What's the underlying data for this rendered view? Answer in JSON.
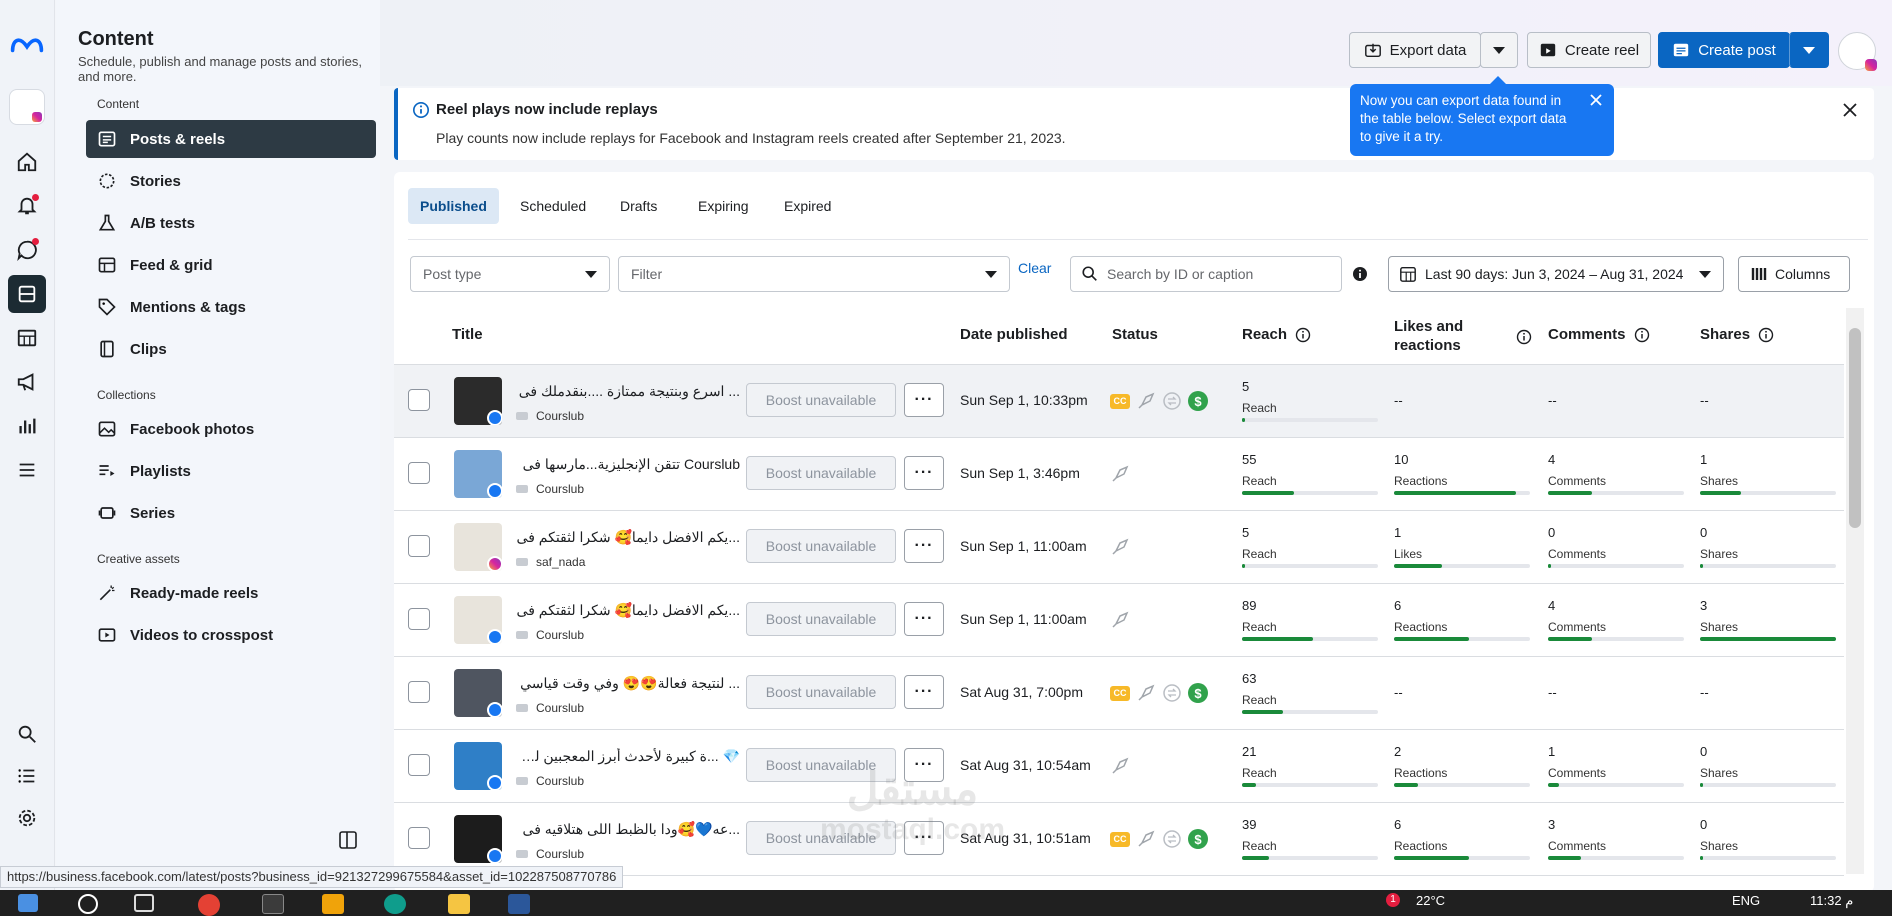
{
  "header": {
    "title": "Content",
    "subtitle": "Schedule, publish and manage posts and stories, and more."
  },
  "sidebar": {
    "sections": [
      {
        "label": "Content",
        "items": [
          {
            "label": "Posts & reels",
            "icon": "posts-icon",
            "active": true
          },
          {
            "label": "Stories",
            "icon": "stories-icon"
          },
          {
            "label": "A/B tests",
            "icon": "flask-icon"
          },
          {
            "label": "Feed & grid",
            "icon": "grid-icon"
          },
          {
            "label": "Mentions & tags",
            "icon": "tag-icon"
          },
          {
            "label": "Clips",
            "icon": "clips-icon"
          }
        ]
      },
      {
        "label": "Collections",
        "items": [
          {
            "label": "Facebook photos",
            "icon": "photo-icon"
          },
          {
            "label": "Playlists",
            "icon": "playlist-icon"
          },
          {
            "label": "Series",
            "icon": "series-icon"
          }
        ]
      },
      {
        "label": "Creative assets",
        "items": [
          {
            "label": "Ready-made reels",
            "icon": "magic-wand-icon"
          },
          {
            "label": "Videos to crosspost",
            "icon": "video-icon"
          }
        ]
      }
    ]
  },
  "toolbar": {
    "export_label": "Export data",
    "create_reel_label": "Create reel",
    "create_post_label": "Create post"
  },
  "banner": {
    "title": "Reel plays now include replays",
    "text": "Play counts now include replays for Facebook and Instagram reels created after September 21, 2023."
  },
  "tooltip": {
    "text": "Now you can export data found in the table below. Select export data to give it a try."
  },
  "tabs": [
    "Published",
    "Scheduled",
    "Drafts",
    "Expiring",
    "Expired"
  ],
  "filters": {
    "post_type_placeholder": "Post type",
    "filter_placeholder": "Filter",
    "clear_label": "Clear",
    "search_placeholder": "Search by ID or caption",
    "date_range": "Last 90 days: Jun 3, 2024 – Aug 31, 2024",
    "columns_label": "Columns"
  },
  "table": {
    "headers": {
      "title": "Title",
      "date": "Date published",
      "status": "Status",
      "reach": "Reach",
      "likes": "Likes and reactions",
      "comments": "Comments",
      "shares": "Shares"
    },
    "boost_label": "Boost unavailable",
    "more_label": "···",
    "dash": "--",
    "rows": [
      {
        "caption": "... اسرع وبنتيجة ممتازة ....بنقدملك فى",
        "account": "Courslub",
        "platform": "facebook",
        "date": "Sun Sep 1, 10:33pm",
        "status": [
          "cc",
          "boost",
          "crosspost",
          "monetized"
        ],
        "reach": "5",
        "reach_label": "Reach",
        "reach_fill": 0.02,
        "likes": null,
        "comments": null,
        "shares": null
      },
      {
        "caption": "Courslub تتقن الإنجليزية...مارسها فى",
        "account": "Courslub",
        "platform": "facebook",
        "date": "Sun Sep 1, 3:46pm",
        "status": [
          "boost"
        ],
        "reach": "55",
        "reach_label": "Reach",
        "reach_fill": 0.38,
        "likes": "10",
        "likes_label": "Reactions",
        "likes_fill": 0.9,
        "comments": "4",
        "comments_label": "Comments",
        "comments_fill": 0.32,
        "shares": "1",
        "shares_label": "Shares",
        "shares_fill": 0.3
      },
      {
        "caption": "...يكم الافضل دايما🥰 شكرا لثقتكم فى",
        "account": "saf_nada",
        "platform": "instagram",
        "date": "Sun Sep 1, 11:00am",
        "status": [
          "boost"
        ],
        "reach": "5",
        "reach_label": "Reach",
        "reach_fill": 0.02,
        "likes": "1",
        "likes_label": "Likes",
        "likes_fill": 0.35,
        "comments": "0",
        "comments_label": "Comments",
        "comments_fill": 0.02,
        "shares": "0",
        "shares_label": "Shares",
        "shares_fill": 0.02
      },
      {
        "caption": "...يكم الافضل دايما🥰 شكرا لثقتكم فى",
        "account": "Courslub",
        "platform": "facebook",
        "date": "Sun Sep 1, 11:00am",
        "status": [
          "boost"
        ],
        "reach": "89",
        "reach_label": "Reach",
        "reach_fill": 0.52,
        "likes": "6",
        "likes_label": "Reactions",
        "likes_fill": 0.55,
        "comments": "4",
        "comments_label": "Comments",
        "comments_fill": 0.32,
        "shares": "3",
        "shares_label": "Shares",
        "shares_fill": 1.0
      },
      {
        "caption": "... لنتيجة فعالة😍😍 وفي وقت قياسي",
        "account": "Courslub",
        "platform": "facebook",
        "date": "Sat Aug 31, 7:00pm",
        "status": [
          "cc",
          "boost",
          "crosspost",
          "monetized"
        ],
        "reach": "63",
        "reach_label": "Reach",
        "reach_fill": 0.3,
        "likes": null,
        "comments": null,
        "shares": null
      },
      {
        "caption": "💎 ...ة كبيرة لأحدث أبرز المعجبين لديّ!",
        "account": "Courslub",
        "platform": "facebook",
        "date": "Sat Aug 31, 10:54am",
        "status": [
          "boost"
        ],
        "reach": "21",
        "reach_label": "Reach",
        "reach_fill": 0.1,
        "likes": "2",
        "likes_label": "Reactions",
        "likes_fill": 0.18,
        "comments": "1",
        "comments_label": "Comments",
        "comments_fill": 0.08,
        "shares": "0",
        "shares_label": "Shares",
        "shares_fill": 0.02
      },
      {
        "caption": "...عه💙🥰ودا بالظبط اللى هتلاقيه فى",
        "account": "Courslub",
        "platform": "facebook",
        "date": "Sat Aug 31, 10:51am",
        "status": [
          "cc",
          "boost",
          "crosspost",
          "monetized"
        ],
        "reach": "39",
        "reach_label": "Reach",
        "reach_fill": 0.2,
        "likes": "6",
        "likes_label": "Reactions",
        "likes_fill": 0.55,
        "comments": "3",
        "comments_label": "Comments",
        "comments_fill": 0.24,
        "shares": "0",
        "shares_label": "Shares",
        "shares_fill": 0.02
      }
    ]
  },
  "browser_status_url": "https://business.facebook.com/latest/posts?business_id=921327299675584&asset_id=102287508770786",
  "taskbar": {
    "temperature": "22°C",
    "lang": "ENG",
    "time": "11:32 م",
    "badge": "1"
  },
  "watermark": {
    "line1": "مستقل",
    "line2": "mostaql.com"
  },
  "colors": {
    "accent": "#0a66c2",
    "tooltip": "#1877f2",
    "metric_bar": "#1a8a3a",
    "active_nav": "#2d3a44"
  }
}
